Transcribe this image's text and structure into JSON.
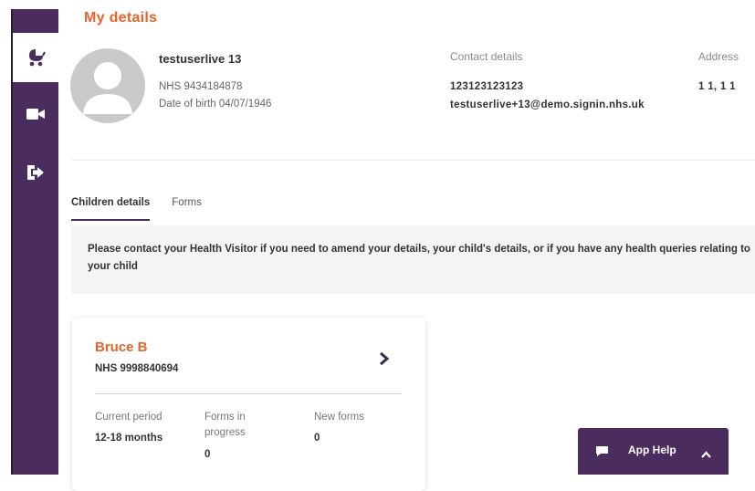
{
  "page": {
    "title": "My details"
  },
  "sidebar": {
    "items": [
      {
        "icon": "stroller-icon",
        "active": true
      },
      {
        "icon": "video-camera-icon",
        "active": false
      },
      {
        "icon": "logout-icon",
        "active": false
      }
    ]
  },
  "profile": {
    "name": "testuserlive 13",
    "nhs": "NHS 9434184878",
    "dob": "Date of birth 04/07/1946"
  },
  "contact": {
    "heading": "Contact details",
    "phone": "123123123123",
    "email": "testuserlive+13@demo.signin.nhs.uk"
  },
  "address": {
    "heading": "Address",
    "value": "1 1, 1 1"
  },
  "tabs": [
    {
      "label": "Children details",
      "active": true
    },
    {
      "label": "Forms",
      "active": false
    }
  ],
  "notice": {
    "text": "Please contact your Health Visitor if you need to amend your details, your child's details, or if you have any health queries relating to your child"
  },
  "child": {
    "name": "Bruce B",
    "nhs": "NHS 9998840694",
    "current_period_label": "Current period",
    "current_period_value": "12-18 months",
    "forms_in_progress_label_1": "Forms in",
    "forms_in_progress_label_2": "progress",
    "forms_in_progress_value": "0",
    "new_forms_label": "New forms",
    "new_forms_value": "0"
  },
  "help": {
    "label": "App Help"
  },
  "colors": {
    "brand": "#4a2d5e",
    "accent": "#e8632b"
  }
}
